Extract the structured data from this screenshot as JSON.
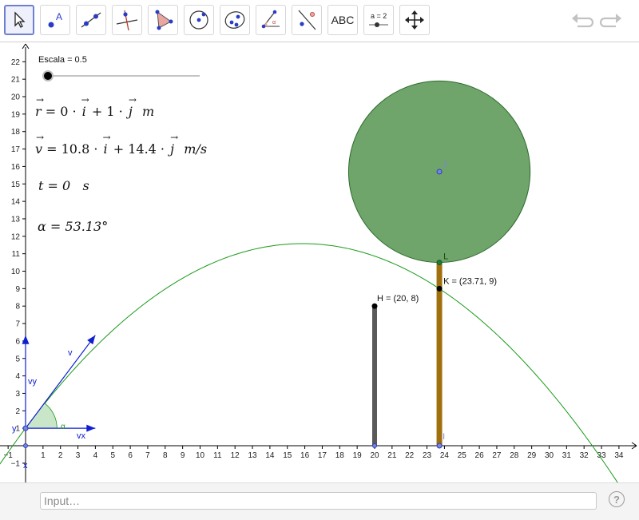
{
  "toolbar": {
    "tools": [
      {
        "name": "move-tool",
        "icon": "cursor-arrow-icon",
        "selected": true
      },
      {
        "name": "point-tool",
        "icon": "point-a-icon"
      },
      {
        "name": "line-tool",
        "icon": "line-through-points-icon"
      },
      {
        "name": "perpendicular-line-tool",
        "icon": "perpendicular-line-icon"
      },
      {
        "name": "polygon-tool",
        "icon": "polygon-icon"
      },
      {
        "name": "circle-tool",
        "icon": "circle-center-point-icon"
      },
      {
        "name": "conic-tool",
        "icon": "ellipse-icon"
      },
      {
        "name": "angle-tool",
        "icon": "angle-icon"
      },
      {
        "name": "reflect-tool",
        "icon": "reflect-about-line-icon"
      },
      {
        "name": "text-tool",
        "label": "ABC"
      },
      {
        "name": "slider-tool",
        "label": "a = 2"
      },
      {
        "name": "move-graphics-view-tool",
        "icon": "move-arrows-icon"
      }
    ],
    "undo_icon": "undo-icon",
    "redo_icon": "redo-icon"
  },
  "slider": {
    "label": "Escala = 0.5",
    "value": 0.5,
    "level": 0.0
  },
  "formulas": {
    "r": {
      "lhs": "r",
      "eq": " = 0 · ",
      "mid": " + 1 · ",
      "unit": "m"
    },
    "v": {
      "lhs": "v",
      "eq": " = 10.8 · ",
      "mid": " + 14.4 · ",
      "unit": "m/s"
    },
    "t": {
      "text": "t = 0",
      "unit": "s"
    },
    "alpha": {
      "text": "α = 53.13°"
    }
  },
  "graph": {
    "x_ticks": [
      -1,
      1,
      2,
      3,
      4,
      5,
      6,
      7,
      8,
      9,
      10,
      11,
      12,
      13,
      14,
      15,
      16,
      17,
      18,
      19,
      20,
      21,
      22,
      23,
      24,
      25,
      26,
      27,
      28,
      29,
      30,
      31,
      32,
      33,
      34
    ],
    "y_ticks": [
      -1,
      1,
      2,
      3,
      4,
      5,
      6,
      7,
      8,
      9,
      10,
      11,
      12,
      13,
      14,
      15,
      16,
      17,
      18,
      19,
      20,
      21,
      22
    ],
    "points": {
      "H": {
        "label": "H = (20, 8)",
        "x": 20,
        "y": 8
      },
      "K": {
        "label": "K = (23.71, 9)",
        "x": 23.71,
        "y": 9
      },
      "L": {
        "label": "L",
        "x": 23.71,
        "y": 10.5
      },
      "J": {
        "label": "J",
        "x": 23.71,
        "y": 15.7
      },
      "I": {
        "label": "I",
        "x": 23.71,
        "y": 0
      }
    },
    "circle_radius": 5.2,
    "vector_labels": {
      "v": "v",
      "vy": "vy",
      "vx": "vx",
      "alpha": "α",
      "x": "x",
      "y": "y"
    },
    "parabola": {
      "vx": 10.8,
      "vy": 14.4,
      "g": 9.8,
      "y0": 1
    },
    "colors": {
      "parabola": "#1a9a1a",
      "vectors": "#1020d0",
      "circle_fill": "#6fa56a",
      "circle_stroke": "#2c6b2c",
      "pole_brown": "#a0700f",
      "pole_gray": "#5a5a5a",
      "angle_fill": "#c9e6c9"
    }
  },
  "input": {
    "placeholder": "Input…"
  },
  "help_label": "?"
}
